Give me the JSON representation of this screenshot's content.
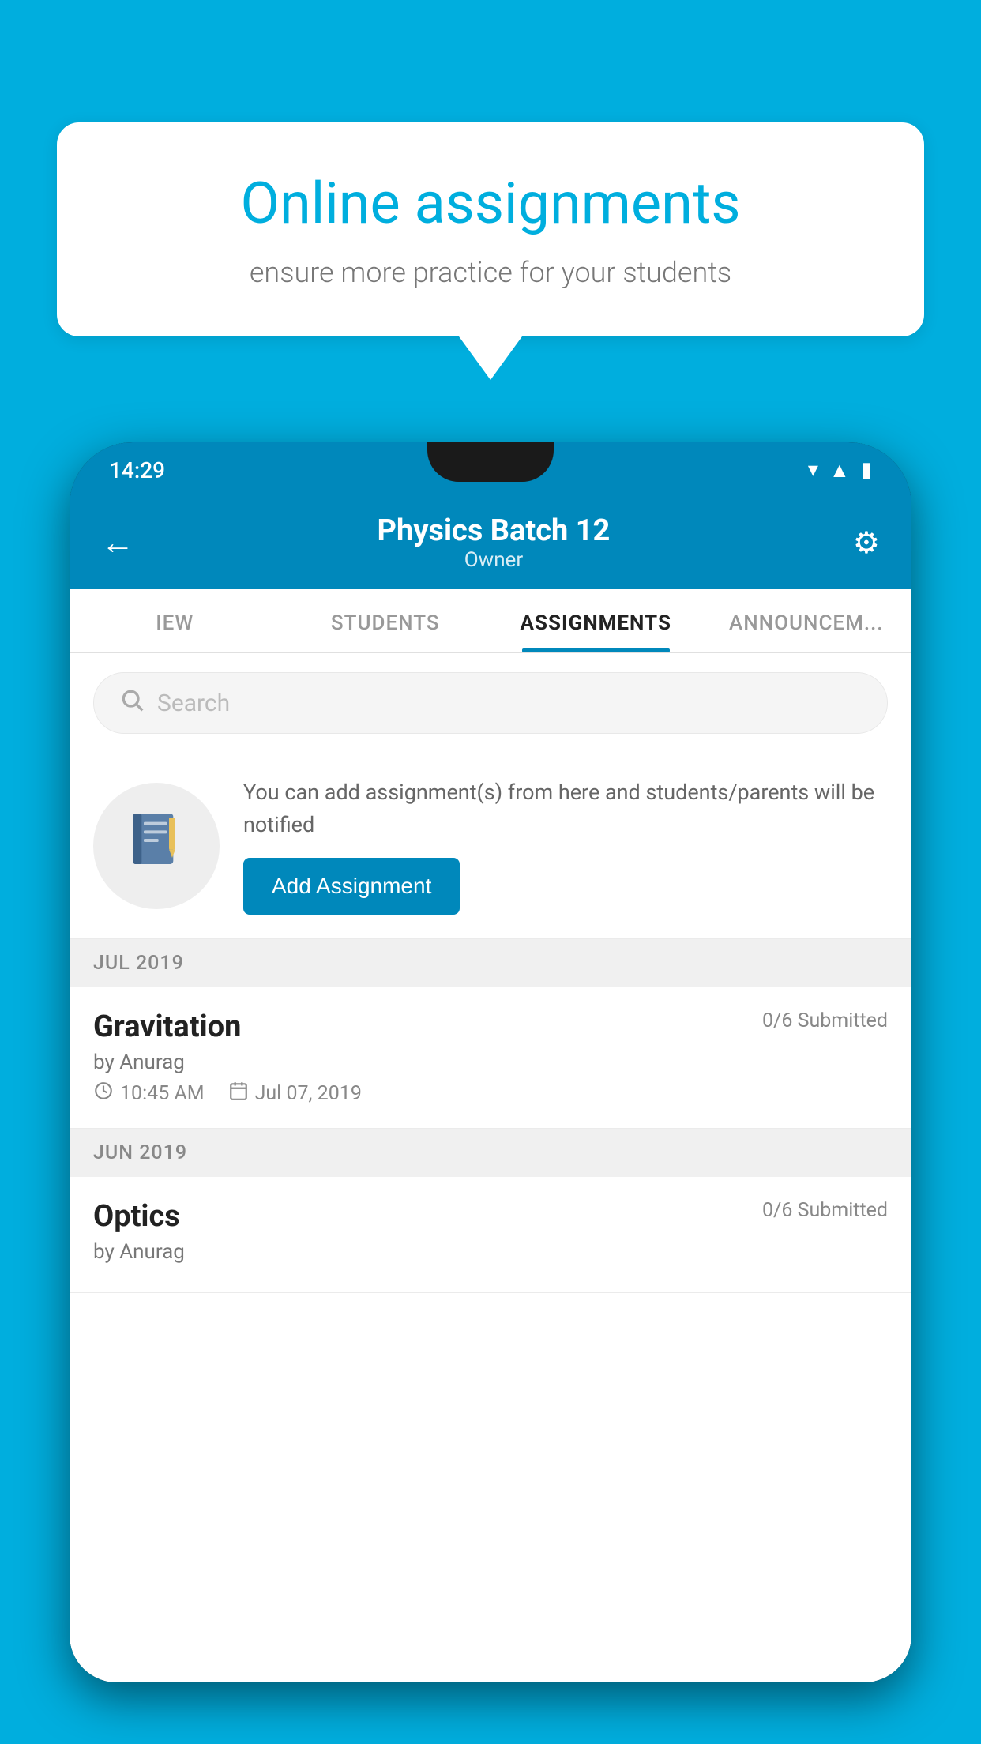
{
  "background_color": "#00AEDE",
  "speech_bubble": {
    "title": "Online assignments",
    "subtitle": "ensure more practice for your students"
  },
  "phone": {
    "status_bar": {
      "time": "14:29"
    },
    "header": {
      "title": "Physics Batch 12",
      "subtitle": "Owner",
      "back_label": "←",
      "settings_label": "⚙"
    },
    "tabs": [
      {
        "label": "IEW",
        "active": false
      },
      {
        "label": "STUDENTS",
        "active": false
      },
      {
        "label": "ASSIGNMENTS",
        "active": true
      },
      {
        "label": "ANNOUNCEM...",
        "active": false
      }
    ],
    "search": {
      "placeholder": "Search"
    },
    "info_banner": {
      "text": "You can add assignment(s) from here and students/parents will be notified",
      "button_label": "Add Assignment"
    },
    "sections": [
      {
        "month": "JUL 2019",
        "assignments": [
          {
            "title": "Gravitation",
            "submitted": "0/6 Submitted",
            "author": "by Anurag",
            "time": "10:45 AM",
            "date": "Jul 07, 2019"
          }
        ]
      },
      {
        "month": "JUN 2019",
        "assignments": [
          {
            "title": "Optics",
            "submitted": "0/6 Submitted",
            "author": "by Anurag",
            "time": "",
            "date": ""
          }
        ]
      }
    ]
  }
}
